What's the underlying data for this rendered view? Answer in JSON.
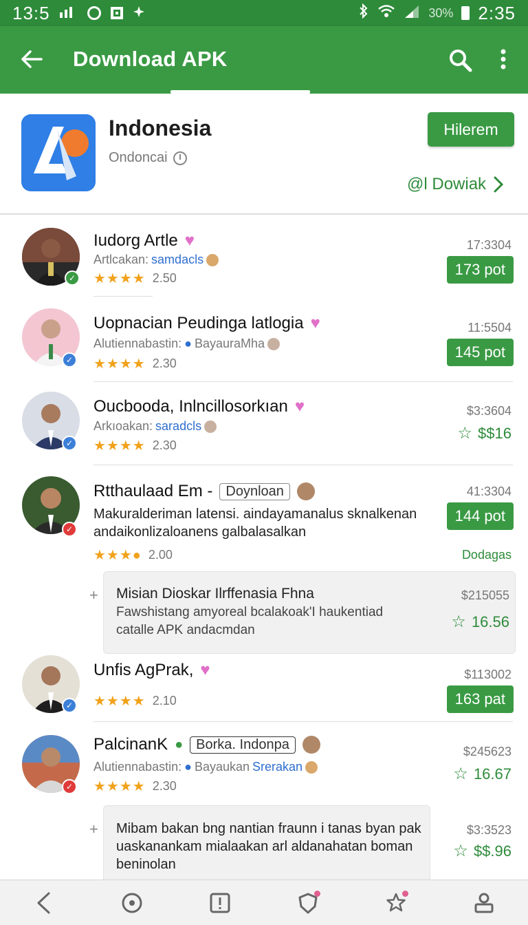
{
  "statusbar": {
    "left_time": "13:5",
    "clock": "2:35",
    "battery": "30%"
  },
  "appbar": {
    "title": "Download APK"
  },
  "app": {
    "name": "Indonesia",
    "subtitle": "Ondoncai",
    "primary_button": "Hilerem",
    "secondary_link": "@l Dowiak"
  },
  "rows": [
    {
      "name": "Iudorg Artle",
      "meta_prefix": "Artlcakan:",
      "meta_highlight": "samdacls",
      "rating": "2.50",
      "time": "17:3304",
      "value": "173 pot"
    },
    {
      "name": "Uopnacian Peudinga latlogia",
      "meta_prefix": "Alutiennabastin:",
      "meta_highlight": "BayauraMha",
      "rating": "2.30",
      "time": "11:5504",
      "value": "145 pot"
    },
    {
      "name": "Oucbooda, Inlncillosorkıan",
      "meta_prefix": "Arkıoakan:",
      "meta_highlight": "saradcls",
      "rating": "2.30",
      "time": "$3:3604",
      "value": "$$16"
    },
    {
      "name": "Rtthaulaad Em -",
      "tag": "Doynloan",
      "body": "Makuralderiman latensi. aindayamanalus sknalkenan andaikonlizaloanens galbalasalkan",
      "rating": "2.00",
      "time": "41:3304",
      "value": "144 pot",
      "link": "Dodagas"
    },
    {
      "name": "Unfis AgPrak,",
      "rating": "2.10",
      "time": "$113002",
      "value": "163 pat"
    },
    {
      "name": "PalcinanK",
      "tag": "Borka. Indonpa",
      "meta_prefix": "Alutiennabastin:",
      "meta_highlight_plain": "Bayaukan",
      "meta_highlight": "Srerakan",
      "rating": "2.30",
      "time": "$245623",
      "value": "16.67"
    }
  ],
  "reply1": {
    "title": "Misian Dioskar Ilrffenasia Fhna",
    "body": "Fawshistang amyoreal bcalakoak'I haukentiad catalle APK andacmdan",
    "time": "$215055",
    "value": "16.56"
  },
  "reply2": {
    "body": "Mibam bakan bng nantian fraunn i tanas byan pak uaskanankam mialaakan arl aldanahatan boman beninolan",
    "time": "$3:3523",
    "value": "$$.96"
  }
}
